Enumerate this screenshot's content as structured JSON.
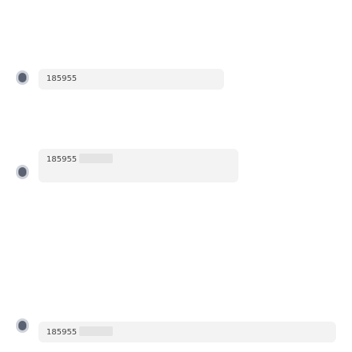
{
  "chat": {
    "system_notice_line1": "",
    "system_notice_line2": "",
    "timestamp": "",
    "messages": [
      {
        "text": "",
        "number_fragment": "185955"
      },
      {
        "text": "",
        "number_fragment": "185955"
      },
      {
        "text": "",
        "number_fragment": "185955"
      }
    ],
    "last_message_tail": ""
  }
}
